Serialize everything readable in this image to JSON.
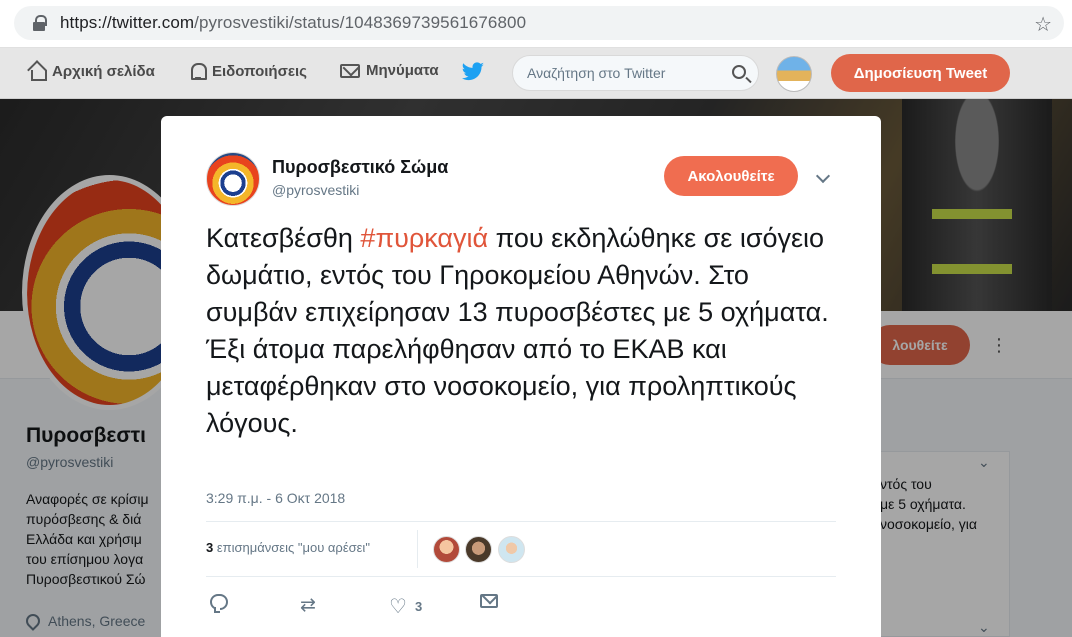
{
  "browser": {
    "url_host": "https://twitter.com",
    "url_path": "/pyrosvestiki/status/1048369739561676800",
    "bookmark_icon": "star-icon"
  },
  "nav": {
    "home_label": "Αρχική σελίδα",
    "notifications_label": "Ειδοποιήσεις",
    "messages_label": "Μηνύματα",
    "search_placeholder": "Αναζήτηση στο Twitter",
    "tweet_button_label": "Δημοσίευση Tweet",
    "brand_color": "#1da1f2",
    "accent_color": "#e0664a"
  },
  "profile_bg": {
    "name": "Πυροσβεστι",
    "handle": "@pyrosvestiki",
    "bio": "Αναφορές σε κρίσιμ\nπυρόσβεσης & διά\nΕλλάδα και χρήσιμ\nτου επίσημου λογα\nΠυροσβεστικού Σώ",
    "location": "Athens, Greece",
    "follow_label": "λουθείτε",
    "side_text": "ντός του\nμε 5 οχήματα.\nνοσοκομείο, για"
  },
  "tweet": {
    "author_name": "Πυροσβεστικό Σώμα",
    "author_handle": "@pyrosvestiki",
    "follow_label": "Ακολουθείτε",
    "text_before": "Κατεσβέσθη ",
    "hashtag": "#πυρκαγιά",
    "text_after": " που εκδηλώθηκε σε ισόγειο δωμάτιο, εντός του Γηροκομείου Αθηνών. Στο συμβάν επιχείρησαν 13 πυροσβέστες με 5 οχήματα. Έξι άτομα παρελήφθησαν από το ΕΚΑΒ και μεταφέρθηκαν στο νοσοκομείο, για προληπτικούς λόγους.",
    "timestamp": "3:29 π.μ. - 6 Οκτ 2018",
    "likes_count": "3",
    "likes_label": "επισημάνσεις \"μου αρέσει\"",
    "like_action_count": "3",
    "retweet_glyph": "⇄",
    "heart_glyph": "♡"
  }
}
